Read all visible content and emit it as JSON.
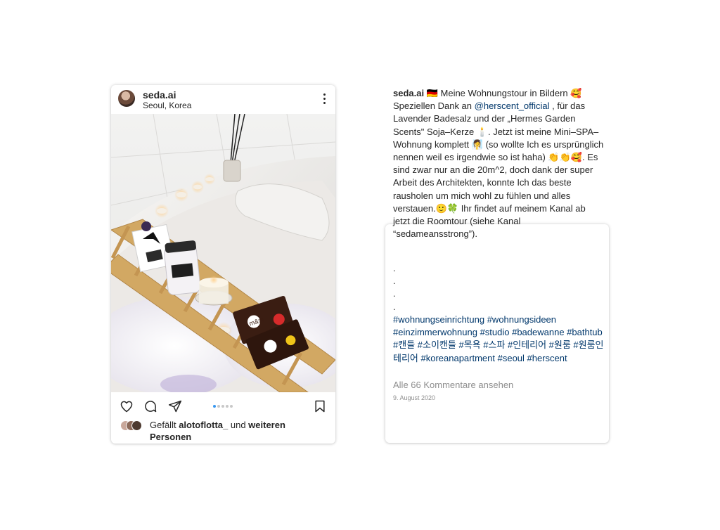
{
  "post": {
    "username": "seda.ai",
    "location": "Seoul, Korea",
    "carousel_dots": 5,
    "carousel_active": 1,
    "likes_prefix": "Gefällt ",
    "likes_user": "alotoflotta_",
    "likes_mid": " und ",
    "likes_rest": "weiteren Personen"
  },
  "caption": {
    "username": "seda.ai",
    "text_1": " 🇩🇪 Meine Wohnungstour in Bildern 🥰 Speziellen Dank an ",
    "mention": "@herscent_official",
    "text_2": " , für das Lavender Badesalz und der „Hermes Garden Scents\" Soja–Kerze 🕯️. Jetzt ist meine Mini–SPA– Wohnung komplett 🧖‍♀️ (so wollte Ich es ursprünglich nennen weil es irgendwie so ist haha) 👏👏🥰. Es sind zwar nur an die 20m^2, doch dank der super Arbeit des Architekten, konnte Ich das beste rausholen um mich wohl zu fühlen und alles verstauen.🙂🍀 Ihr findet auf meinem Kanal ab jetzt die Roomtour (siehe Kanal “sedameansstrong”).",
    "dots": [
      ".",
      ".",
      ".",
      "."
    ],
    "hashtags": "#wohnungseinrichtung #wohnungsideen #einzimmerwohnung #studio #badewanne #bathtub #캔들 #소이캔들 #목욕 #스파 #인테리어 #원룸 #원룸인테리어 #koreanapartment #seoul #herscent",
    "comments_link": "Alle 66 Kommentare ansehen",
    "date": "9. August 2020"
  },
  "colors": {
    "link": "#00376b",
    "muted": "#8e8e8e",
    "carousel_active": "#3897f0"
  },
  "icons": [
    "more-options-icon",
    "heart-icon",
    "comment-icon",
    "share-icon",
    "bookmark-icon"
  ]
}
